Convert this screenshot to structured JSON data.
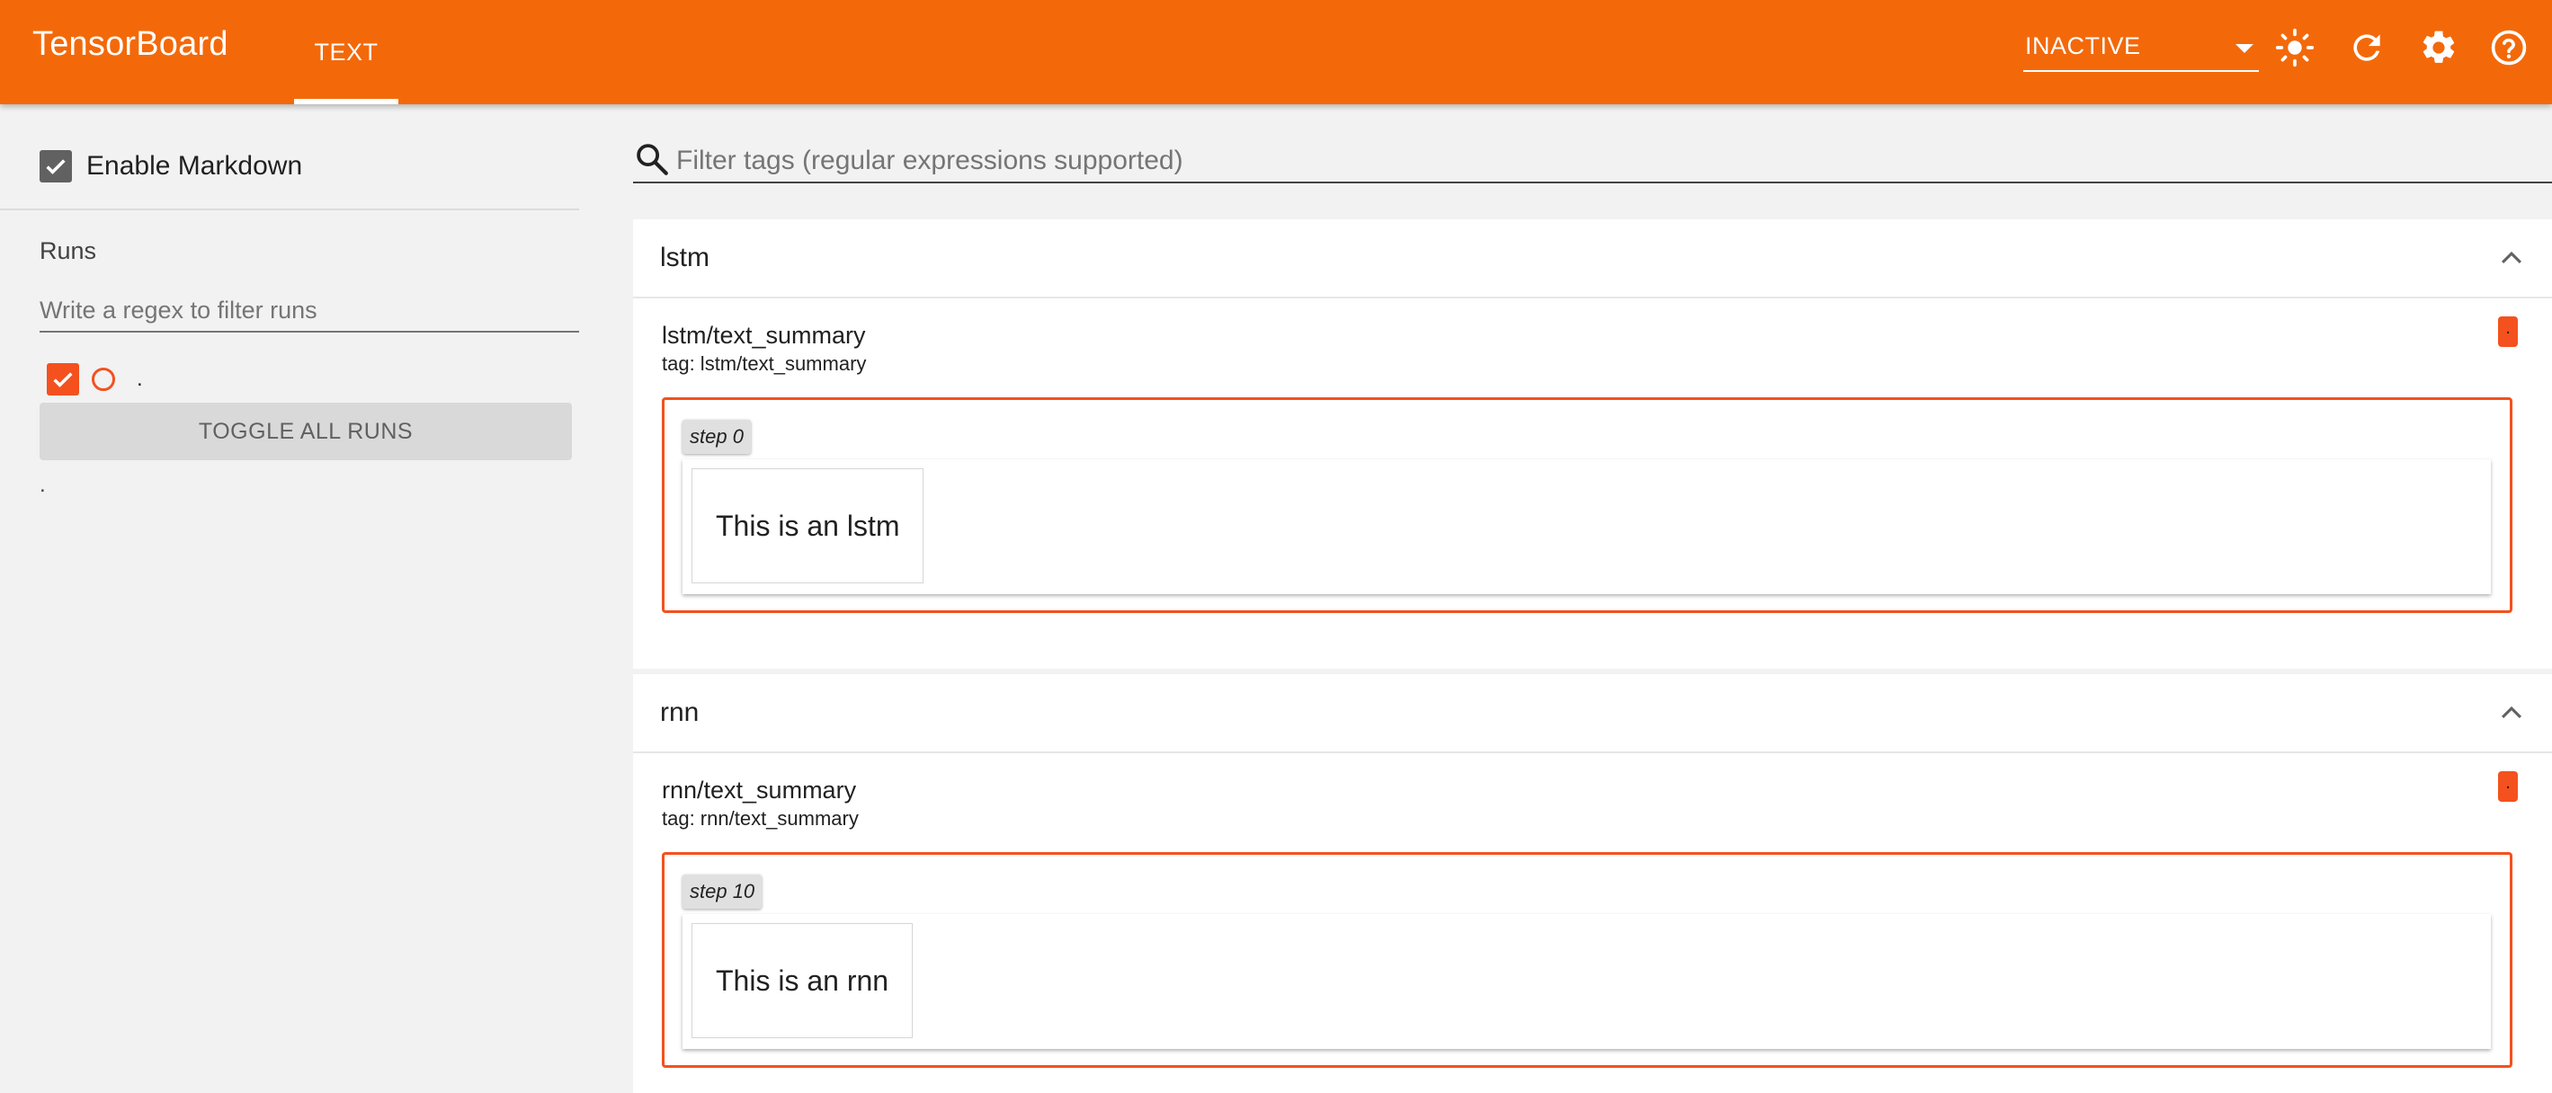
{
  "header": {
    "brand": "TensorBoard",
    "tab": "TEXT",
    "reload_status": "INACTIVE",
    "icons": [
      "theme-sun-icon",
      "refresh-icon",
      "settings-gear-icon",
      "help-icon"
    ],
    "accent_color": "#f3690a"
  },
  "sidebar": {
    "enable_markdown": {
      "label": "Enable Markdown",
      "checked": true
    },
    "runs_title": "Runs",
    "runs_filter_placeholder": "Write a regex to filter runs",
    "runs": [
      {
        "name": ".",
        "checked": true,
        "color": "#f4511e"
      }
    ],
    "toggle_all_label": "TOGGLE ALL RUNS",
    "footer_run": "."
  },
  "main": {
    "tag_filter_placeholder": "Filter tags (regular expressions supported)",
    "panes": [
      {
        "title": "lstm",
        "card": {
          "name": "lstm/text_summary",
          "tag": "tag: lstm/text_summary",
          "run_badge": ".",
          "step": "step 0",
          "text": "This is an lstm"
        }
      },
      {
        "title": "rnn",
        "card": {
          "name": "rnn/text_summary",
          "tag": "tag: rnn/text_summary",
          "run_badge": ".",
          "step": "step 10",
          "text": "This is an rnn"
        }
      }
    ]
  }
}
